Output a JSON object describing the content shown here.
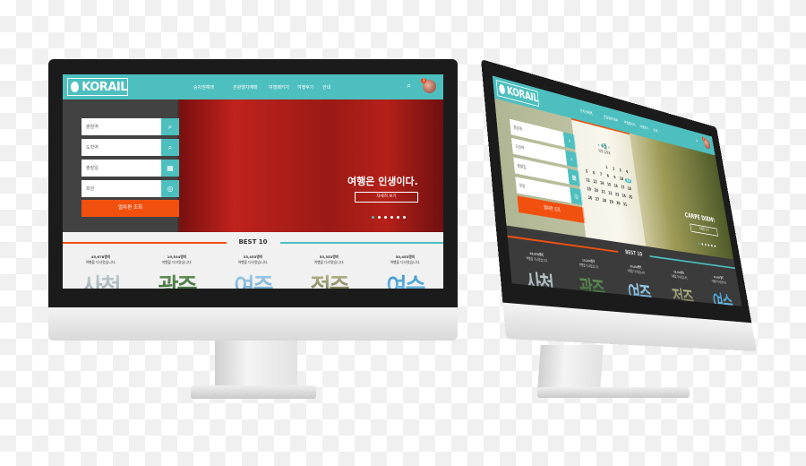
{
  "colors": {
    "brand": "#4cbfbe",
    "accent": "#f2500f"
  },
  "left": {
    "logo": "KORAIL",
    "nav": [
      "승차권예매",
      "관광열차예매",
      "여행패키지",
      "여행후기",
      "안내"
    ],
    "notification_count": "3",
    "fields": [
      {
        "label": "출발역",
        "icon": "search-icon"
      },
      {
        "label": "도착역",
        "icon": "search-icon"
      },
      {
        "label": "출발일",
        "icon": "calendar-icon"
      },
      {
        "label": "회원",
        "icon": "person-icon"
      }
    ],
    "search_button": "열차편 조회",
    "hero": {
      "headline": "여행은 인생이다.",
      "button": "자세히 보기",
      "slides": 6,
      "active_slide": 1
    },
    "best": {
      "title": "BEST 10",
      "items": [
        {
          "count": "45,678명이",
          "caption": "여행을 다녀왔습니다.",
          "city": "사천"
        },
        {
          "count": "10,334명이",
          "caption": "여행을 다녀왔습니다.",
          "city": "광주"
        },
        {
          "count": "33,453명이",
          "caption": "여행을 다녀왔습니다.",
          "city": "여주"
        },
        {
          "count": "53,353명이",
          "caption": "여행을 다녀왔습니다.",
          "city": "전주"
        },
        {
          "count": "30,453명이",
          "caption": "여행을 다녀왔습니다.",
          "city": "여수"
        }
      ]
    }
  },
  "right": {
    "logo": "KORAIL",
    "nav": [
      "승차권예매",
      "관광열차예매",
      "여행패키지",
      "여행후기",
      "안내"
    ],
    "notification_count": "3",
    "fields": [
      {
        "label": "출발역",
        "icon": "search-icon"
      },
      {
        "label": "도착역",
        "icon": "search-icon"
      },
      {
        "label": "출발일",
        "icon": "calendar-icon"
      },
      {
        "label": "회원",
        "icon": "person-icon"
      }
    ],
    "search_button": "열차편 조회",
    "calendar": {
      "month": "4월",
      "subtitle": "여행 일정표",
      "first_weekday": 3,
      "days": 31,
      "selected": 11
    },
    "hero": {
      "headline": "CARPE DIEM!",
      "button": "자세히 보기",
      "slides": 6,
      "active_slide": 1
    },
    "best": {
      "title": "BEST 10",
      "items": [
        {
          "count": "45,678명이",
          "caption": "여행을 다녀왔습니다.",
          "city": "사천"
        },
        {
          "count": "10,334명이",
          "caption": "여행을 다녀왔습니다.",
          "city": "광주"
        },
        {
          "count": "33,453명이",
          "caption": "여행을 다녀왔습니다.",
          "city": "여주"
        },
        {
          "count": "53,353명이",
          "caption": "여행을 다녀왔습니다.",
          "city": "전주"
        },
        {
          "count": "30,453명이",
          "caption": "여행을 다녀왔습니다.",
          "city": "여수"
        }
      ]
    }
  }
}
